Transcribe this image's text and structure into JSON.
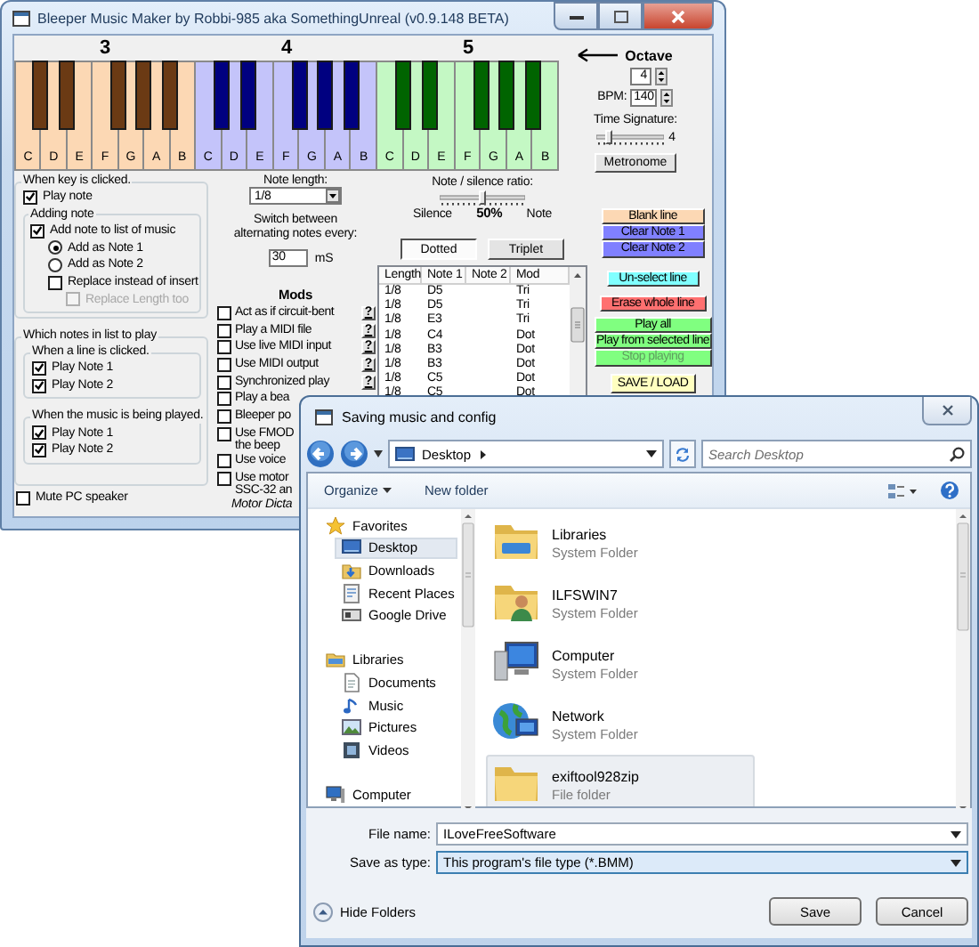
{
  "main_window": {
    "title": "Bleeper Music Maker by Robbi-985 aka SomethingUnreal (v0.9.148 BETA)",
    "octaves": [
      {
        "label": "3",
        "white_keys": {
          "color": "#fcd8b4",
          "labels": [
            "C",
            "D",
            "E",
            "F",
            "G",
            "A",
            "B"
          ]
        },
        "black_keys": {
          "color": "#6b3a14"
        }
      },
      {
        "label": "4",
        "white_keys": {
          "color": "#c4c4fa",
          "labels": [
            "C",
            "D",
            "E",
            "F",
            "G",
            "A",
            "B"
          ]
        },
        "black_keys": {
          "color": "#000080"
        }
      },
      {
        "label": "5",
        "white_keys": {
          "color": "#c4f8c4",
          "labels": [
            "C",
            "D",
            "E",
            "F",
            "G",
            "A",
            "B"
          ]
        },
        "black_keys": {
          "color": "#006400"
        }
      }
    ],
    "octave_control": {
      "label": "Octave",
      "value": "4"
    },
    "bpm": {
      "label": "BPM:",
      "value": "140"
    },
    "time_signature": {
      "label": "Time Signature:",
      "level": 0.2,
      "reading": "4"
    },
    "metronome": "Metronome",
    "when_key_clicked": {
      "title": "When key is clicked.",
      "play_note": {
        "label": "Play note",
        "checked": true
      },
      "adding_note": {
        "title": "Adding note",
        "options": [
          {
            "kind": "checkbox",
            "label": "Add note to list of music",
            "checked": true,
            "disabled": false,
            "children": [
              {
                "kind": "radio",
                "label": "Add as Note 1",
                "selected": true,
                "disabled": false
              },
              {
                "kind": "radio",
                "label": "Add as Note 2",
                "selected": false,
                "disabled": false
              },
              {
                "kind": "checkbox",
                "label": "Replace instead of insert",
                "checked": false,
                "disabled": false,
                "children": [
                  {
                    "kind": "checkbox",
                    "label": "Replace Length too",
                    "checked": false,
                    "disabled": true
                  }
                ]
              }
            ]
          }
        ]
      }
    },
    "which_notes": {
      "title": "Which notes in list to play",
      "groups": [
        {
          "title": "When a line is clicked.",
          "items": [
            {
              "label": "Play Note 1",
              "checked": true
            },
            {
              "label": "Play Note 2",
              "checked": true
            }
          ]
        },
        {
          "title": "When the music is being played.",
          "items": [
            {
              "label": "Play Note 1",
              "checked": true
            },
            {
              "label": "Play Note 2",
              "checked": true
            }
          ]
        }
      ]
    },
    "mute": {
      "label": "Mute PC speaker",
      "checked": false
    },
    "note_length": {
      "label": "Note length:",
      "value": "1/8"
    },
    "switch_notes": {
      "label": "Switch between alternating notes every:",
      "value": "30",
      "unit": "mS"
    },
    "mods": {
      "title": "Mods",
      "items": [
        {
          "label": "Act as if circuit-bent",
          "checked": false,
          "help": "?"
        },
        {
          "label": "Play a MIDI file",
          "checked": false,
          "help": "?"
        },
        {
          "label": "Use live MIDI input",
          "checked": false,
          "help": "?"
        },
        {
          "label": "Use MIDI output",
          "checked": false,
          "help": "?"
        },
        {
          "label": "Synchronized play",
          "checked": false,
          "help": "?"
        },
        {
          "label": "Play a bea",
          "checked": false
        },
        {
          "label": "Bleeper po",
          "checked": false
        },
        {
          "label": "Use FMOD\nthe beep",
          "checked": false
        },
        {
          "label": "Use voice",
          "checked": false
        },
        {
          "label": "Use motor\nSSC-32 an",
          "checked": false
        }
      ],
      "footer": "Motor Dicta"
    },
    "ratio": {
      "label": "Note / silence ratio:",
      "level": 0.5,
      "left": "Silence",
      "reading": "50%",
      "right": "Note"
    },
    "modifiers": [
      {
        "label": "Dotted",
        "selected": true
      },
      {
        "label": "Triplet",
        "selected": false
      }
    ],
    "list": {
      "columns": [
        "Length",
        "Note 1",
        "Note 2",
        "Mod"
      ],
      "rows": [
        {
          "length": "1/8",
          "note_1": "D5",
          "mod": "Tri"
        },
        {
          "length": "1/8",
          "note_1": "D5",
          "mod": "Tri"
        },
        {
          "length": "1/8",
          "note_1": "E3",
          "mod": "Tri"
        },
        {
          "length": "1/8",
          "note_1": "C4",
          "mod": "Dot"
        },
        {
          "length": "1/8",
          "note_1": "B3",
          "mod": "Dot"
        },
        {
          "length": "1/8",
          "note_1": "B3",
          "mod": "Dot"
        },
        {
          "length": "1/8",
          "note_1": "C5",
          "mod": "Dot"
        },
        {
          "length": "1/8",
          "note_1": "C5",
          "mod": "Dot"
        }
      ]
    },
    "button_groups": [
      [
        {
          "label": "Blank line",
          "color": "#fcd8b4",
          "disabled": false
        },
        {
          "label": "Clear Note 1",
          "color": "#8080ff",
          "disabled": false
        },
        {
          "label": "Clear Note 2",
          "color": "#8080ff",
          "disabled": false
        }
      ],
      [
        {
          "label": "Un-select line",
          "color": "#80ffff",
          "disabled": false
        }
      ],
      [
        {
          "label": "Erase whole line",
          "color": "#ff7070",
          "disabled": false
        }
      ],
      [
        {
          "label": "Play all",
          "color": "#80ff80",
          "disabled": false
        },
        {
          "label": "Play from selected line",
          "color": "#80ff80",
          "disabled": false
        },
        {
          "label": "Stop playing",
          "color": "#80ff80",
          "disabled": true
        }
      ],
      [
        {
          "label": "SAVE / LOAD",
          "color": "#ffffc0",
          "disabled": false
        }
      ]
    ]
  },
  "dialog": {
    "title": "Saving music and config",
    "location": "Desktop",
    "search": {
      "placeholder": "Search Desktop"
    },
    "toolbar": {
      "organize": "Organize",
      "new_folder": "New folder"
    },
    "nav": [
      {
        "label": "Favorites",
        "kind": "star",
        "selected": false,
        "children": [
          {
            "label": "Desktop",
            "kind": "desktop",
            "selected": true
          },
          {
            "label": "Downloads",
            "kind": "downloads",
            "selected": false
          },
          {
            "label": "Recent Places",
            "kind": "recent",
            "selected": false
          },
          {
            "label": "Google Drive",
            "kind": "drive",
            "selected": false
          }
        ]
      },
      {
        "label": "Libraries",
        "kind": "library",
        "selected": false,
        "children": [
          {
            "label": "Documents",
            "kind": "document",
            "selected": false
          },
          {
            "label": "Music",
            "kind": "music",
            "selected": false
          },
          {
            "label": "Pictures",
            "kind": "picture",
            "selected": false
          },
          {
            "label": "Videos",
            "kind": "video",
            "selected": false
          }
        ]
      },
      {
        "label": "Computer",
        "kind": "computer",
        "selected": false
      }
    ],
    "files": [
      {
        "name": "Libraries",
        "type": "System Folder",
        "kind": "library",
        "selected": false
      },
      {
        "name": "ILFSWIN7",
        "type": "System Folder",
        "kind": "user",
        "selected": false
      },
      {
        "name": "Computer",
        "type": "System Folder",
        "kind": "computer",
        "selected": false
      },
      {
        "name": "Network",
        "type": "System Folder",
        "kind": "network",
        "selected": false
      },
      {
        "name": "exiftool928zip",
        "type": "File folder",
        "kind": "folder",
        "selected": true
      }
    ],
    "file_name": {
      "label": "File name:",
      "value": "ILoveFreeSoftware",
      "focused": false
    },
    "save_type": {
      "label": "Save as type:",
      "value": "This program's file type (*.BMM)",
      "focused": true
    },
    "hide_folders": "Hide Folders",
    "buttons": [
      "Save",
      "Cancel"
    ]
  }
}
